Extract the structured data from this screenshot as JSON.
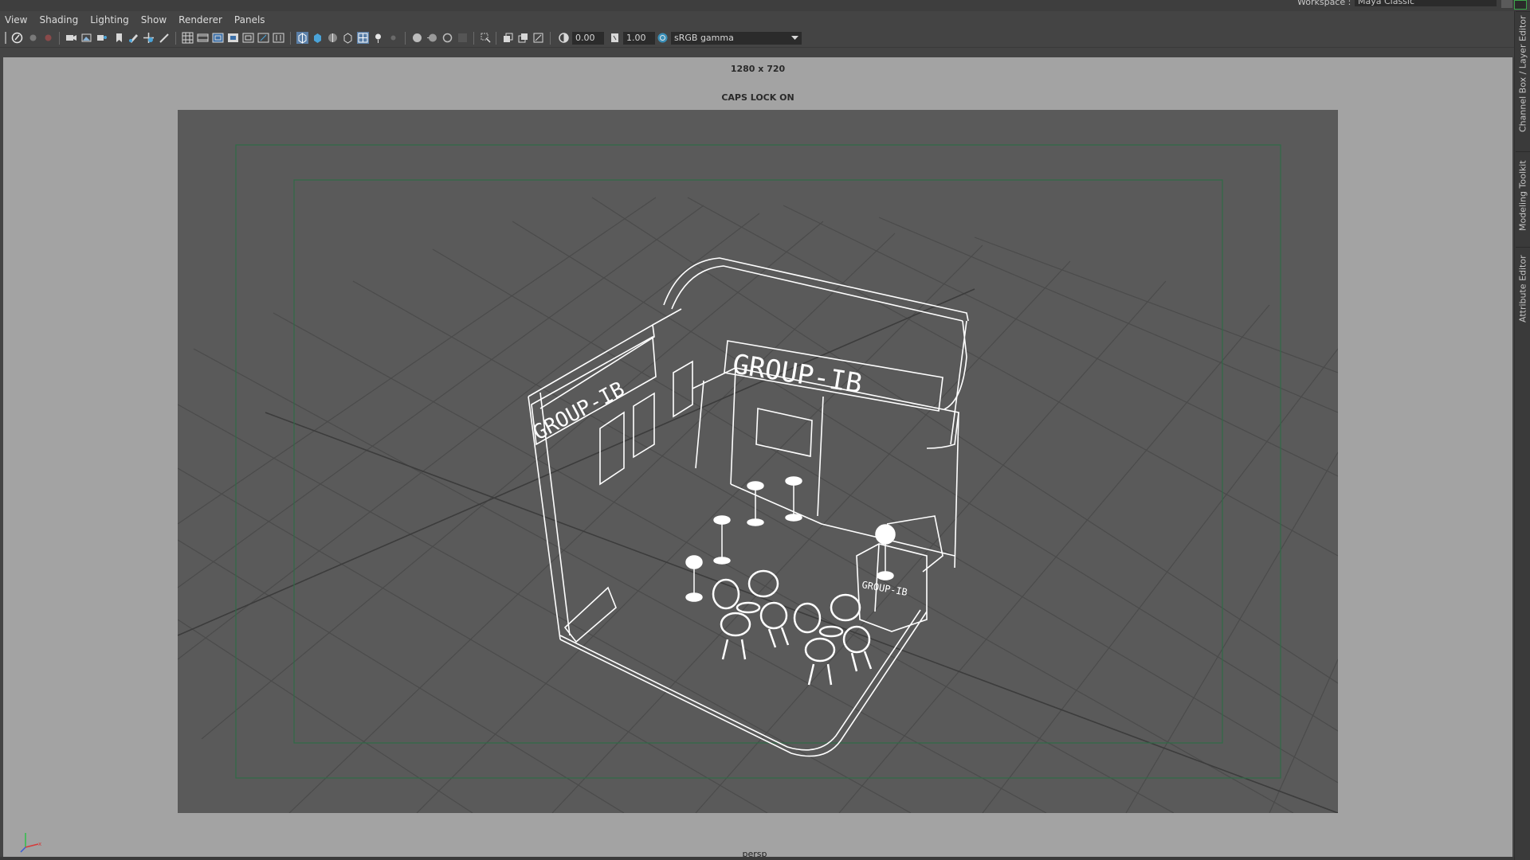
{
  "topbar": {
    "workspace_label": "Workspace :",
    "workspace_value": "Maya Classic"
  },
  "menubar": {
    "items": [
      {
        "label": "View"
      },
      {
        "label": "Shading"
      },
      {
        "label": "Lighting"
      },
      {
        "label": "Show"
      },
      {
        "label": "Renderer"
      },
      {
        "label": "Panels"
      }
    ]
  },
  "toolbar": {
    "exposure_value": "0.00",
    "gamma_value": "1.00",
    "color_space": "sRGB gamma"
  },
  "viewport": {
    "resolution_label": "1280 x 720",
    "caps_lock_label": "CAPS LOCK ON",
    "camera_label": "persp",
    "scene_logo_text": "GROUP-IB"
  },
  "dock": {
    "tabs": [
      {
        "label": "Channel Box / Layer Editor"
      },
      {
        "label": "Modeling Toolkit"
      },
      {
        "label": "Attribute Editor"
      }
    ]
  },
  "colors": {
    "ui_background": "#444444",
    "viewport_background": "#a3a3a3",
    "gate_background": "#5a5a5a",
    "wireframe": "#ffffff",
    "safe_frame": "#2f6b46",
    "grid": "#4a4a4a",
    "accent_green": "#3ba54a"
  },
  "icons": [
    "camera-icon",
    "grid-icon",
    "wireframe-icon",
    "shaded-icon",
    "texture-icon",
    "light-icon",
    "shadow-icon",
    "isolate-icon",
    "exposure-icon",
    "gamma-icon",
    "color-management-icon",
    "axis-gizmo-icon"
  ]
}
